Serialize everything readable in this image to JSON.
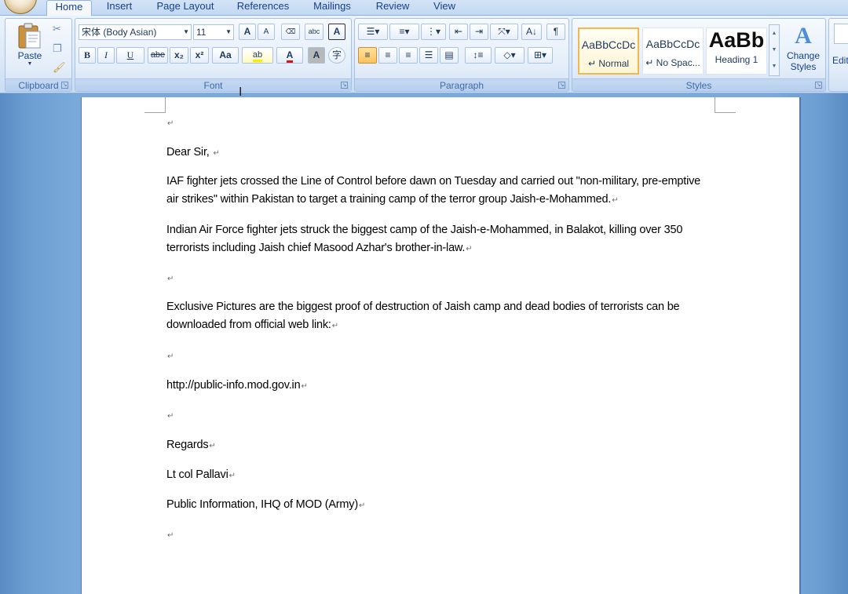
{
  "tabs": [
    {
      "label": "Home",
      "active": true
    },
    {
      "label": "Insert"
    },
    {
      "label": "Page Layout"
    },
    {
      "label": "References"
    },
    {
      "label": "Mailings"
    },
    {
      "label": "Review"
    },
    {
      "label": "View"
    }
  ],
  "ribbon": {
    "clipboard": {
      "label": "Clipboard",
      "paste": "Paste"
    },
    "font": {
      "label": "Font",
      "font_name": "宋体 (Body Asian)",
      "font_size": "11",
      "grow": "A",
      "shrink": "A",
      "bold": "B",
      "italic": "I",
      "underline": "U",
      "strike": "abe",
      "subscript": "x₂",
      "superscript": "x²",
      "change_case": "Aa",
      "highlight": "ab",
      "font_color": "A",
      "char_shading": "A",
      "enclose": "字"
    },
    "paragraph": {
      "label": "Paragraph"
    },
    "styles": {
      "label": "Styles",
      "items": [
        {
          "sample": "AaBbCcDc",
          "name": "↵ Normal",
          "selected": true
        },
        {
          "sample": "AaBbCcDc",
          "name": "↵ No Spac..."
        },
        {
          "sample": "AaBb",
          "name": "Heading 1"
        }
      ],
      "change_styles": "Change Styles"
    },
    "editing": {
      "label": "Editi"
    }
  },
  "document": {
    "greeting": "Dear Sir, ",
    "p1": "IAF fighter jets crossed the Line of Control before dawn on Tuesday and carried out \"non-military, pre-emptive air strikes\" within Pakistan to target a training camp of the terror group Jaish-e-Mohammed.",
    "p2": "Indian Air Force fighter jets struck the biggest camp of  the Jaish-e-Mohammed, in Balakot, killing over 350 terrorists  including Jaish chief  Masood Azhar's  brother-in-law.",
    "p3": "Exclusive Pictures are the biggest proof of  destruction of  Jaish camp and dead bodies of terrorists can be downloaded from official web link:",
    "link": "http://public-info.mod.gov.in",
    "regards": "Regards",
    "sender": "Lt col Pallavi",
    "org": "Public Information, IHQ of MOD (Army)",
    "para_mark": "↵"
  },
  "colors": {
    "ribbon_text": "#15428b",
    "group_label": "#3e6aaa",
    "selected_style_border": "#f3b84b",
    "workspace": "#7aa9da"
  }
}
